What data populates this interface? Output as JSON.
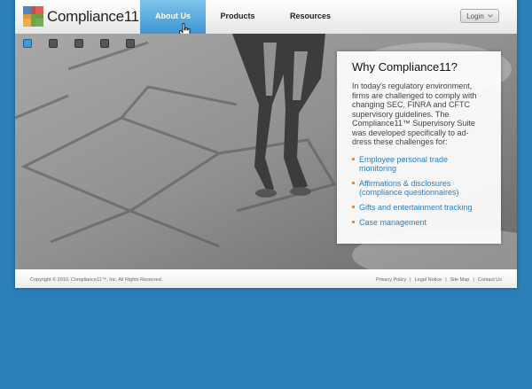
{
  "logo": {
    "name": "Compliance11",
    "mark": "™"
  },
  "nav": [
    {
      "label": "About Us"
    },
    {
      "label": "Products"
    },
    {
      "label": "Resources"
    }
  ],
  "login": {
    "label": "Login"
  },
  "panel": {
    "title": "Why Compliance11?",
    "body": "In today's regulatory environment, firms are challenged to comply with changing SEC, FINRA and CFTC supervisory guidelines. The Compliance11™ Supervisory Suite was developed specifically to ad-dress these challenges for:",
    "items": [
      "Employee personal trade monitoring",
      "Affirmations & disclosures (compliance questionnaires)",
      "Gifts and entertainment tracking",
      "Case management"
    ]
  },
  "footer": {
    "copyright": "Copyright © 2010. Compliance11™, Inc. All Rights Reserved.",
    "links": [
      "Privacy Policy",
      "Legal Notice",
      "Site Map",
      "Contact Us"
    ],
    "separator": "|"
  },
  "colors": {
    "background": "#2a7fb8",
    "accent": "#3f95d1",
    "bullet": "#f08a1d",
    "link": "#2a7fc0"
  }
}
